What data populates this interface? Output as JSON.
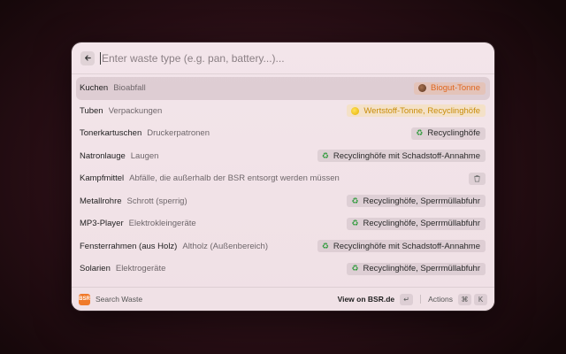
{
  "search": {
    "placeholder": "Enter waste type (e.g. pan, battery...)..."
  },
  "items": [
    {
      "name": "Kuchen",
      "category": "Bioabfall",
      "tag": "Biogut-Tonne",
      "tag_icon": "brown-circle-icon",
      "style": "orange",
      "selected": true
    },
    {
      "name": "Tuben",
      "category": "Verpackungen",
      "tag": "Wertstoff-Tonne, Recyclinghöfe",
      "tag_icon": "yellow-circle-icon",
      "style": "yellow"
    },
    {
      "name": "Tonerkartuschen",
      "category": "Druckerpatronen",
      "tag": "Recyclinghöfe",
      "tag_icon": "recycle-icon",
      "style": "green"
    },
    {
      "name": "Natronlauge",
      "category": "Laugen",
      "tag": "Recyclinghöfe mit Schadstoff-Annahme",
      "tag_icon": "recycle-icon",
      "style": "green"
    },
    {
      "name": "Kampfmittel",
      "category": "Abfälle, die außerhalb der BSR entsorgt werden müssen",
      "tag": "",
      "tag_icon": "trash-icon",
      "style": "icon-only"
    },
    {
      "name": "Metallrohre",
      "category": "Schrott (sperrig)",
      "tag": "Recyclinghöfe, Sperrmüllabfuhr",
      "tag_icon": "recycle-icon",
      "style": "green"
    },
    {
      "name": "MP3-Player",
      "category": "Elektrokleingeräte",
      "tag": "Recyclinghöfe, Sperrmüllabfuhr",
      "tag_icon": "recycle-icon",
      "style": "green"
    },
    {
      "name": "Fensterrahmen (aus Holz)",
      "category": "Altholz (Außenbereich)",
      "tag": "Recyclinghöfe mit Schadstoff-Annahme",
      "tag_icon": "recycle-icon",
      "style": "green"
    },
    {
      "name": "Solarien",
      "category": "Elektrogeräte",
      "tag": "Recyclinghöfe, Sperrmüllabfuhr",
      "tag_icon": "recycle-icon",
      "style": "green"
    }
  ],
  "footer": {
    "app_logo": "BSR",
    "app_name": "Search Waste",
    "primary_action": "View on BSR.de",
    "enter_key": "↵",
    "actions_label": "Actions",
    "cmd_key": "⌘",
    "k_key": "K"
  }
}
